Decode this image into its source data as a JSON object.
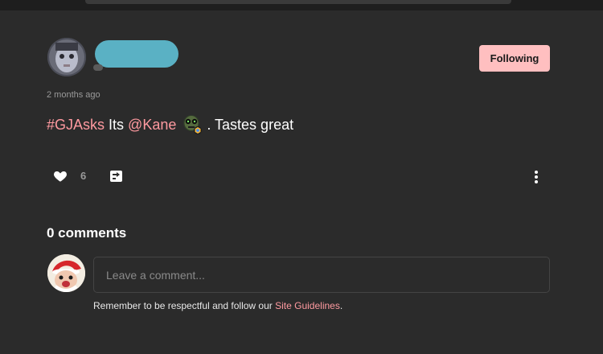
{
  "post": {
    "author_avatar": "user-avatar",
    "follow_label": "Following",
    "timestamp": "2 months ago",
    "hashtag": "#GJAsks",
    "text_part1": " Its ",
    "mention": "@Kane",
    "emoji": "robot-alien-emoji",
    "text_part2": ". Tastes great",
    "like_icon": "heart-icon",
    "like_count": "6",
    "share_icon": "share-icon",
    "more_icon": "kebab-menu-icon"
  },
  "comments": {
    "heading": "0 comments",
    "commenter_avatar": "santa-avatar",
    "input_placeholder": "Leave a comment...",
    "input_value": "",
    "guidelines_prefix": "Remember to be respectful and follow our ",
    "guidelines_link": "Site Guidelines",
    "guidelines_suffix": "."
  },
  "colors": {
    "background": "#2b2b2b",
    "accent_pink": "#ff9aa0",
    "follow_button_bg": "#ffbfc0",
    "redacted_name_blur": "#5ab1c4"
  }
}
